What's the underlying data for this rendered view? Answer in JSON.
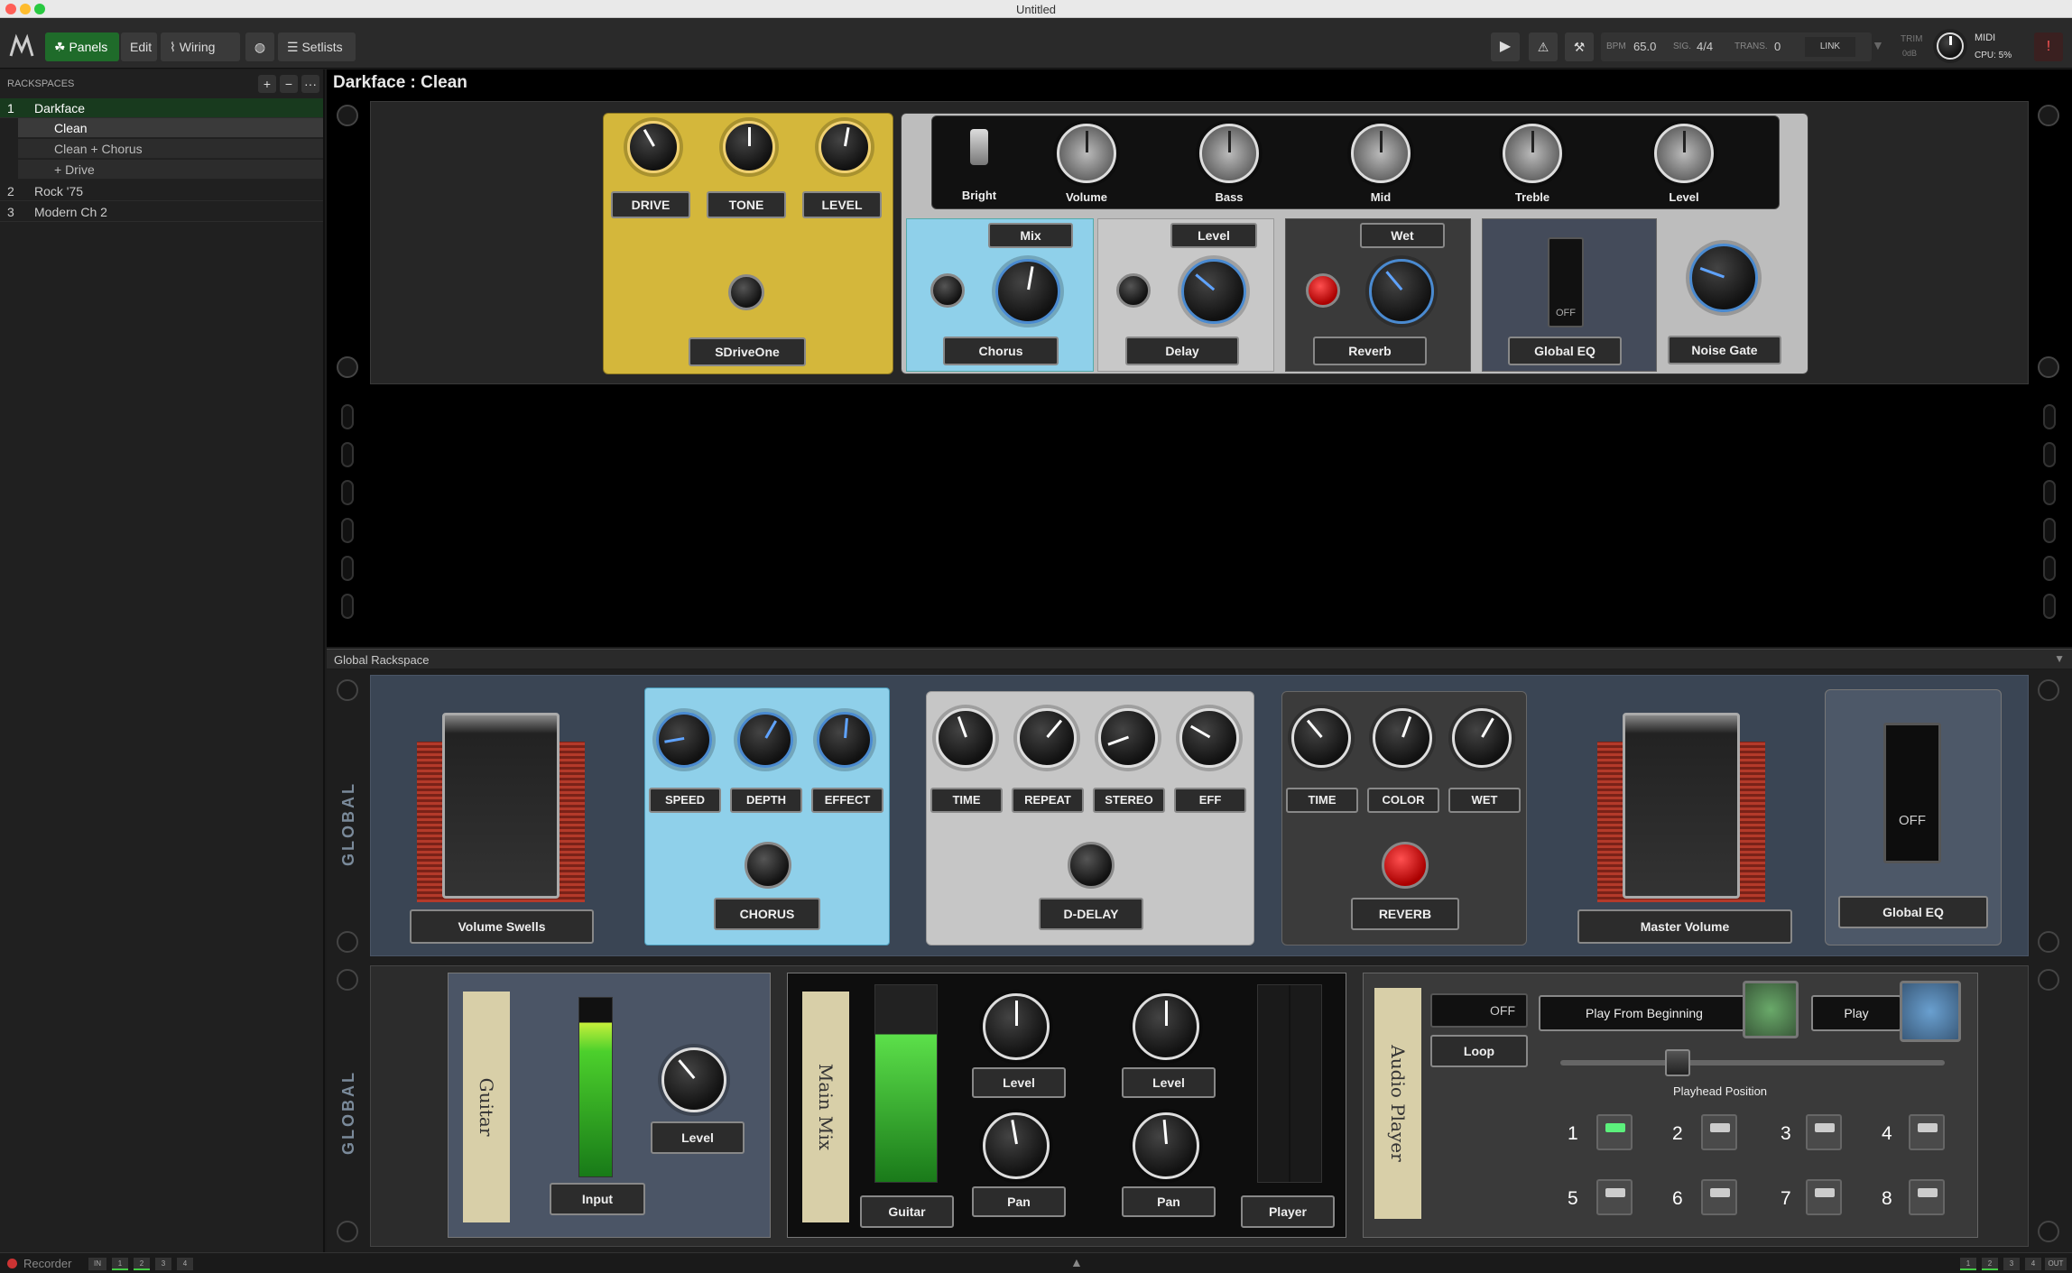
{
  "window": {
    "title": "Untitled"
  },
  "toolbar": {
    "panels": "Panels",
    "edit": "Edit",
    "wiring": "Wiring",
    "setlists": "Setlists",
    "bpm_label": "BPM",
    "bpm": "65.0",
    "sig_label": "SIG.",
    "sig": "4/4",
    "trans_label": "TRANS.",
    "trans": "0",
    "link": "LINK",
    "trim_label": "TRIM",
    "trim_value": "0dB",
    "midi": "MIDI",
    "cpu": "CPU: 5%"
  },
  "sidebar": {
    "header": "RACKSPACES",
    "add": "+",
    "remove": "−",
    "more": "···",
    "rackspaces": [
      {
        "num": "1",
        "name": "Darkface"
      },
      {
        "num": "2",
        "name": "Rock '75"
      },
      {
        "num": "3",
        "name": "Modern Ch 2"
      }
    ],
    "variations": [
      "Clean",
      "Clean + Chorus",
      "+ Drive"
    ]
  },
  "rack": {
    "title": "Darkface : Clean",
    "sdrive": {
      "drive": "DRIVE",
      "tone": "TONE",
      "level": "LEVEL",
      "name": "SDriveOne"
    },
    "amp": {
      "bright": "Bright",
      "volume": "Volume",
      "bass": "Bass",
      "mid": "Mid",
      "treble": "Treble",
      "level": "Level"
    },
    "fx": {
      "mix": "Mix",
      "chorus": "Chorus",
      "level": "Level",
      "delay": "Delay",
      "wet": "Wet",
      "reverb": "Reverb",
      "globaleq": "Global EQ",
      "eq_off": "OFF",
      "noisegate": "Noise Gate"
    }
  },
  "global": {
    "title": "Global Rackspace",
    "vert1": "GLOBAL",
    "vert2": "GLOBAL",
    "volswells": "Volume Swells",
    "chorus": {
      "speed": "SPEED",
      "depth": "DEPTH",
      "effect": "EFFECT",
      "name": "CHORUS"
    },
    "delay": {
      "time": "TIME",
      "repeat": "REPEAT",
      "stereo": "STEREO",
      "eff": "EFF",
      "name": "D-DELAY"
    },
    "reverb": {
      "time": "TIME",
      "color": "COLOR",
      "wet": "WET",
      "name": "REVERB"
    },
    "mastervol": "Master Volume",
    "globaleq": "Global EQ",
    "eq_off": "OFF",
    "guitar_tape": "Guitar",
    "input_level": "Level",
    "input": "Input",
    "mainmix_tape": "Main Mix",
    "guitar": "Guitar",
    "level1": "Level",
    "level2": "Level",
    "pan1": "Pan",
    "pan2": "Pan",
    "player": "Player",
    "audioplayer_tape": "Audio Player",
    "onoff": "OFF",
    "loop": "Loop",
    "play_from_beginning": "Play From Beginning",
    "play": "Play",
    "playhead": "Playhead Position",
    "nums": [
      "1",
      "2",
      "3",
      "4",
      "5",
      "6",
      "7",
      "8"
    ]
  },
  "status": {
    "recorder": "Recorder",
    "in": "IN",
    "ch": [
      "1",
      "2",
      "3",
      "4"
    ],
    "out": "OUT"
  }
}
